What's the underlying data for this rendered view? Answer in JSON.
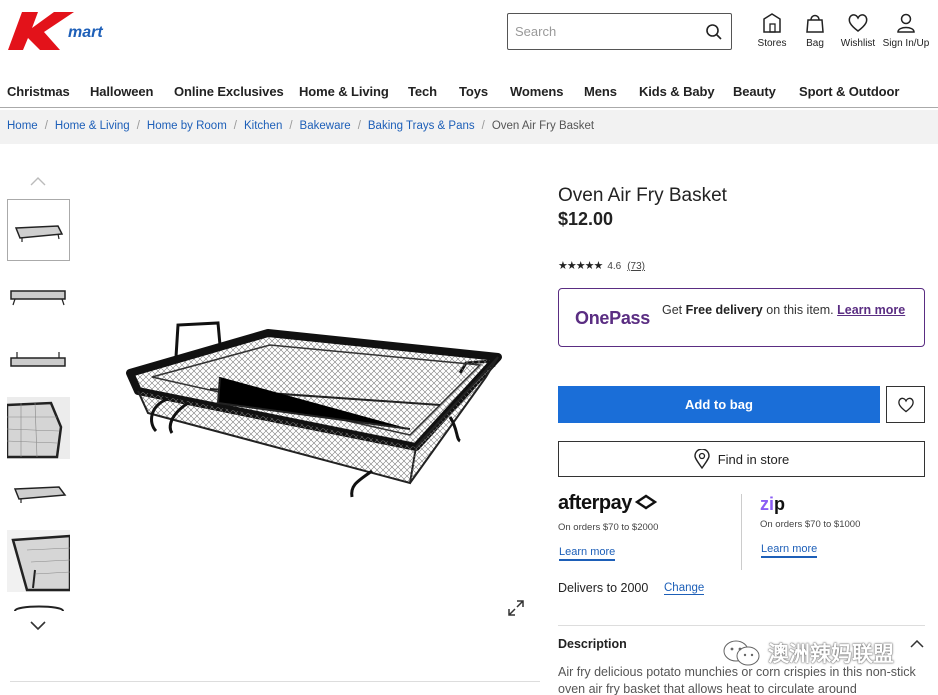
{
  "brand": {
    "logo_text": "mart",
    "logo_color": "#e3121a"
  },
  "search": {
    "placeholder": "Search"
  },
  "header_icons": [
    {
      "label": "Stores",
      "icon": "store-icon"
    },
    {
      "label": "Bag",
      "icon": "bag-icon"
    },
    {
      "label": "Wishlist",
      "icon": "heart-icon"
    },
    {
      "label": "Sign In/Up",
      "icon": "user-icon"
    }
  ],
  "nav": [
    "Christmas",
    "Halloween",
    "Online Exclusives",
    "Home & Living",
    "Tech",
    "Toys",
    "Womens",
    "Mens",
    "Kids & Baby",
    "Beauty",
    "Sport & Outdoor"
  ],
  "breadcrumb": [
    "Home",
    "Home & Living",
    "Home by Room",
    "Kitchen",
    "Bakeware",
    "Baking Trays & Pans"
  ],
  "breadcrumb_current": "Oven Air Fry Basket",
  "product": {
    "title": "Oven Air Fry Basket",
    "price": "$12.00",
    "stars": "★★★★★",
    "rating": "4.6",
    "reviews": "(73)"
  },
  "onepass": {
    "logo": "OnePass",
    "text_pre": "Get ",
    "text_bold": "Free delivery",
    "text_post": " on this item. ",
    "learn": "Learn more",
    "color": "#5a2d82"
  },
  "actions": {
    "add_to_bag": "Add to bag",
    "find_in_store": "Find in store",
    "accent": "#1a6ed8"
  },
  "afterpay": {
    "logo": "afterpay",
    "range": "On orders $70 to $2000",
    "learn": "Learn more"
  },
  "zip": {
    "logo_z": "zi",
    "logo_rest": "p",
    "range": "On orders $70 to $1000",
    "learn": "Learn more"
  },
  "delivery": {
    "text": "Delivers to 2000",
    "change": "Change"
  },
  "description": {
    "heading": "Description",
    "text": "Air fry delicious potato munchies or corn crispies in this non-stick oven air fry basket that allows heat to circulate around"
  },
  "watermark": {
    "text": "澳洲辣妈联盟"
  }
}
